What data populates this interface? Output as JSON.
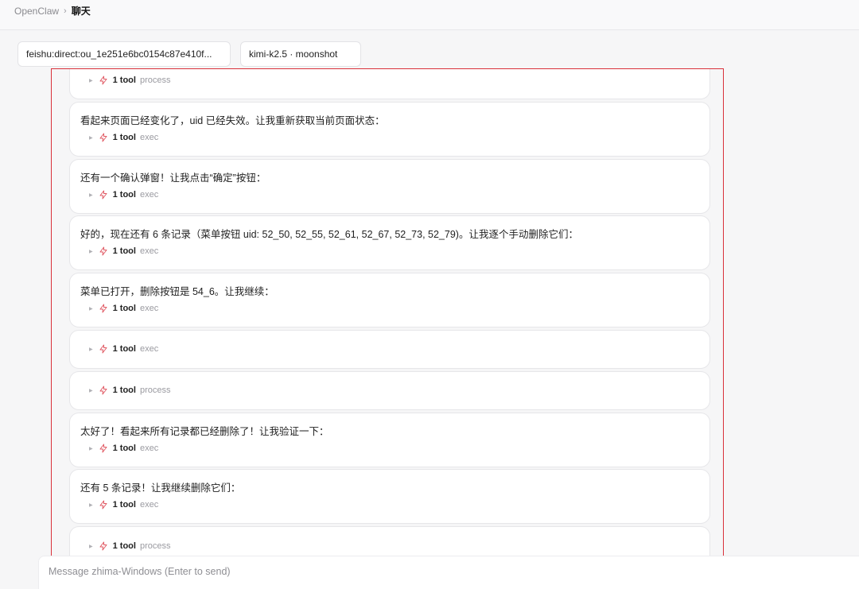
{
  "breadcrumb": {
    "app": "OpenClaw",
    "separator": "›",
    "current": "聊天"
  },
  "selectors": {
    "session": "feishu:direct:ou_1e251e6bc0154c87e410f...",
    "model": "kimi-k2.5 · moonshot"
  },
  "icons": {
    "tool": "lightning-bolt-icon",
    "expand": "caret-right-icon"
  },
  "colors": {
    "highlight_border": "#d9303a",
    "bolt": "#e05a64"
  },
  "messages": [
    {
      "text": "",
      "tool_count": "1 tool",
      "tool_name": "process"
    },
    {
      "text": "看起来页面已经变化了，uid 已经失效。让我重新获取当前页面状态：",
      "tool_count": "1 tool",
      "tool_name": "exec"
    },
    {
      "text": "还有一个确认弹窗！让我点击“确定”按钮：",
      "tool_count": "1 tool",
      "tool_name": "exec"
    },
    {
      "text": "好的，现在还有 6 条记录（菜单按钮 uid: 52_50, 52_55, 52_61, 52_67, 52_73, 52_79)。让我逐个手动删除它们：",
      "tool_count": "1 tool",
      "tool_name": "exec"
    },
    {
      "text": "菜单已打开，删除按钮是 54_6。让我继续：",
      "tool_count": "1 tool",
      "tool_name": "exec"
    },
    {
      "text": "",
      "tool_count": "1 tool",
      "tool_name": "exec"
    },
    {
      "text": "",
      "tool_count": "1 tool",
      "tool_name": "process"
    },
    {
      "text": "太好了！看起来所有记录都已经删除了！让我验证一下：",
      "tool_count": "1 tool",
      "tool_name": "exec"
    },
    {
      "text": "还有 5 条记录！让我继续删除它们：",
      "tool_count": "1 tool",
      "tool_name": "exec"
    },
    {
      "text": "",
      "tool_count": "1 tool",
      "tool_name": "process"
    }
  ],
  "composer": {
    "placeholder": "Message zhima-Windows (Enter to send)",
    "value": ""
  }
}
